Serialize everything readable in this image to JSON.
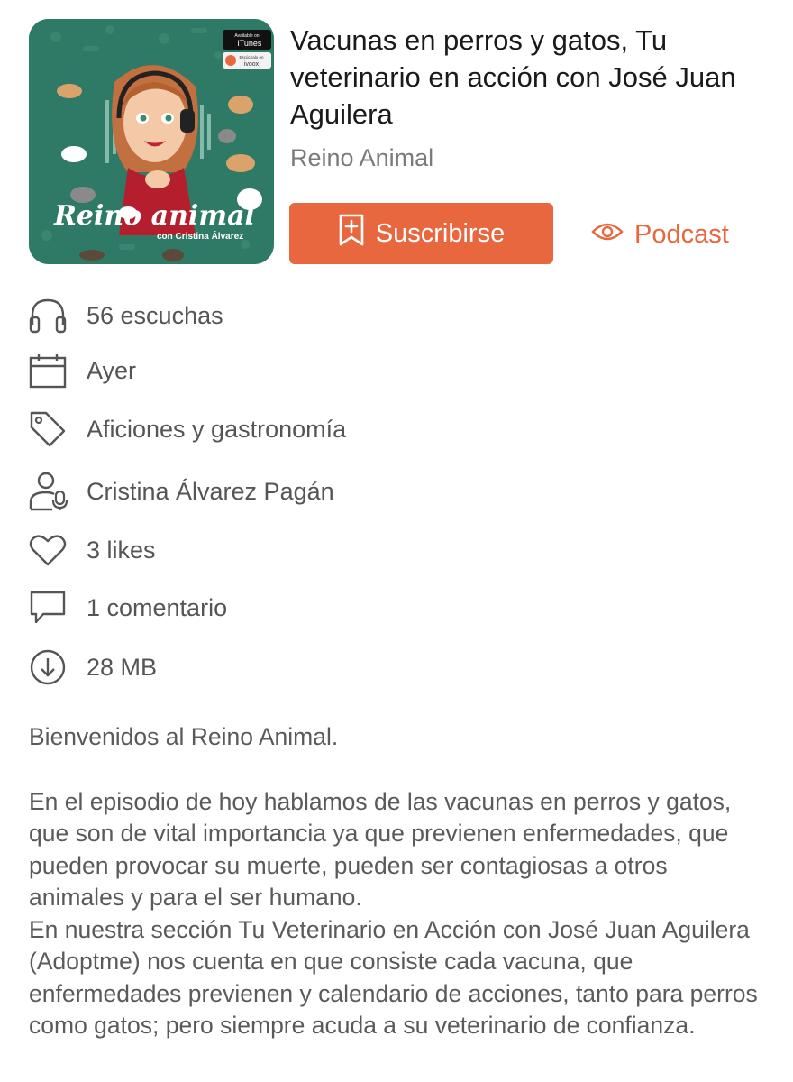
{
  "episode": {
    "title": "Vacunas en perros y gatos, Tu veterinario en acción con José Juan Aguilera",
    "show": "Reino Animal"
  },
  "cover": {
    "script_title": "Reino animal",
    "subtitle": "con Cristina Álvarez",
    "badge_top": "iTunes",
    "badge_top_small": "Available on",
    "badge_bottom": "ivoox",
    "badge_bottom_small": "Escúchalo en"
  },
  "actions": {
    "subscribe_label": "Suscribirse",
    "podcast_label": "Podcast"
  },
  "meta": {
    "listens": "56 escuchas",
    "date": "Ayer",
    "category": "Aficiones y gastronomía",
    "author": "Cristina Álvarez Pagán",
    "likes": "3 likes",
    "comments": "1 comentario",
    "size": "28 MB"
  },
  "description": {
    "intro": "Bienvenidos al Reino Animal.",
    "body": "En el episodio de hoy hablamos de las vacunas en perros y gatos, que son de vital importancia ya que previenen enfermedades, que pueden provocar su muerte, pueden ser contagiosas a otros animales y para el ser humano.\nEn nuestra sección Tu Veterinario en Acción con José Juan Aguilera (Adoptme) nos cuenta en que consiste cada vacuna, que enfermedades previenen y calendario de acciones, tanto para perros como gatos; pero siempre acuda a su veterinario de confianza."
  },
  "colors": {
    "accent": "#e8673e",
    "cover_bg": "#2e7a66",
    "muted_text": "#7a7a7a"
  },
  "icons": [
    "headphones-icon",
    "calendar-icon",
    "tag-icon",
    "user-mic-icon",
    "heart-icon",
    "comment-icon",
    "download-icon",
    "bookmark-plus-icon",
    "eye-icon"
  ]
}
